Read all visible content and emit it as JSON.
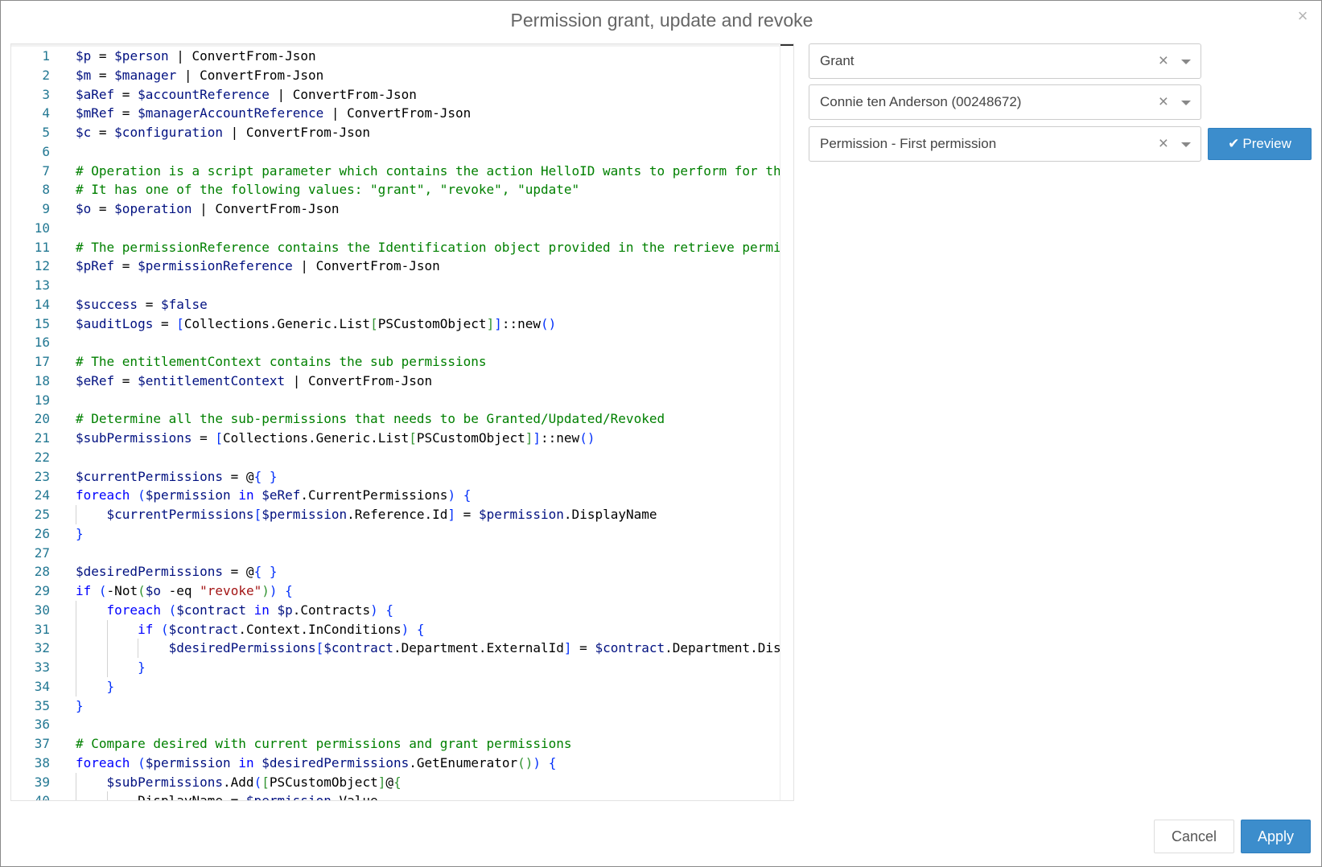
{
  "dialog": {
    "title": "Permission grant, update and revoke",
    "close_icon": "×"
  },
  "editor": {
    "lines": [
      {
        "n": "1",
        "t": "$p = $person | ConvertFrom-Json"
      },
      {
        "n": "2",
        "t": "$m = $manager | ConvertFrom-Json"
      },
      {
        "n": "3",
        "t": "$aRef = $accountReference | ConvertFrom-Json"
      },
      {
        "n": "4",
        "t": "$mRef = $managerAccountReference | ConvertFrom-Json"
      },
      {
        "n": "5",
        "t": "$c = $configuration | ConvertFrom-Json"
      },
      {
        "n": "6",
        "t": ""
      },
      {
        "n": "7",
        "t": "# Operation is a script parameter which contains the action HelloID wants to perform for this"
      },
      {
        "n": "8",
        "t": "# It has one of the following values: \"grant\", \"revoke\", \"update\""
      },
      {
        "n": "9",
        "t": "$o = $operation | ConvertFrom-Json"
      },
      {
        "n": "10",
        "t": ""
      },
      {
        "n": "11",
        "t": "# The permissionReference contains the Identification object provided in the retrieve permiss"
      },
      {
        "n": "12",
        "t": "$pRef = $permissionReference | ConvertFrom-Json"
      },
      {
        "n": "13",
        "t": ""
      },
      {
        "n": "14",
        "t": "$success = $false"
      },
      {
        "n": "15",
        "t": "$auditLogs = [Collections.Generic.List[PSCustomObject]]::new()"
      },
      {
        "n": "16",
        "t": ""
      },
      {
        "n": "17",
        "t": "# The entitlementContext contains the sub permissions"
      },
      {
        "n": "18",
        "t": "$eRef = $entitlementContext | ConvertFrom-Json"
      },
      {
        "n": "19",
        "t": ""
      },
      {
        "n": "20",
        "t": "# Determine all the sub-permissions that needs to be Granted/Updated/Revoked"
      },
      {
        "n": "21",
        "t": "$subPermissions = [Collections.Generic.List[PSCustomObject]]::new()"
      },
      {
        "n": "22",
        "t": ""
      },
      {
        "n": "23",
        "t": "$currentPermissions = @{ }"
      },
      {
        "n": "24",
        "t": "foreach ($permission in $eRef.CurrentPermissions) {"
      },
      {
        "n": "25",
        "t": "    $currentPermissions[$permission.Reference.Id] = $permission.DisplayName"
      },
      {
        "n": "26",
        "t": "}"
      },
      {
        "n": "27",
        "t": ""
      },
      {
        "n": "28",
        "t": "$desiredPermissions = @{ }"
      },
      {
        "n": "29",
        "t": "if (-Not($o -eq \"revoke\")) {"
      },
      {
        "n": "30",
        "t": "    foreach ($contract in $p.Contracts) {"
      },
      {
        "n": "31",
        "t": "        if ($contract.Context.InConditions) {"
      },
      {
        "n": "32",
        "t": "            $desiredPermissions[$contract.Department.ExternalId] = $contract.Department.Displ"
      },
      {
        "n": "33",
        "t": "        }"
      },
      {
        "n": "34",
        "t": "    }"
      },
      {
        "n": "35",
        "t": "}"
      },
      {
        "n": "36",
        "t": ""
      },
      {
        "n": "37",
        "t": "# Compare desired with current permissions and grant permissions"
      },
      {
        "n": "38",
        "t": "foreach ($permission in $desiredPermissions.GetEnumerator()) {"
      },
      {
        "n": "39",
        "t": "    $subPermissions.Add([PSCustomObject]@{"
      },
      {
        "n": "40",
        "t": "        DisplayName = $permission.Value"
      }
    ]
  },
  "form": {
    "operation": {
      "value": "Grant"
    },
    "person": {
      "value": "Connie ten Anderson (00248672)"
    },
    "permission": {
      "value": "Permission - First permission"
    },
    "clear_icon": "×"
  },
  "buttons": {
    "preview_label": "Preview",
    "preview_icon": "✔",
    "cancel_label": "Cancel",
    "apply_label": "Apply"
  },
  "colors": {
    "primary": "#3c8dcc",
    "comment": "#008000",
    "variable": "#001080",
    "keyword": "#0000ff",
    "string": "#a31515",
    "line_number": "#237893"
  }
}
